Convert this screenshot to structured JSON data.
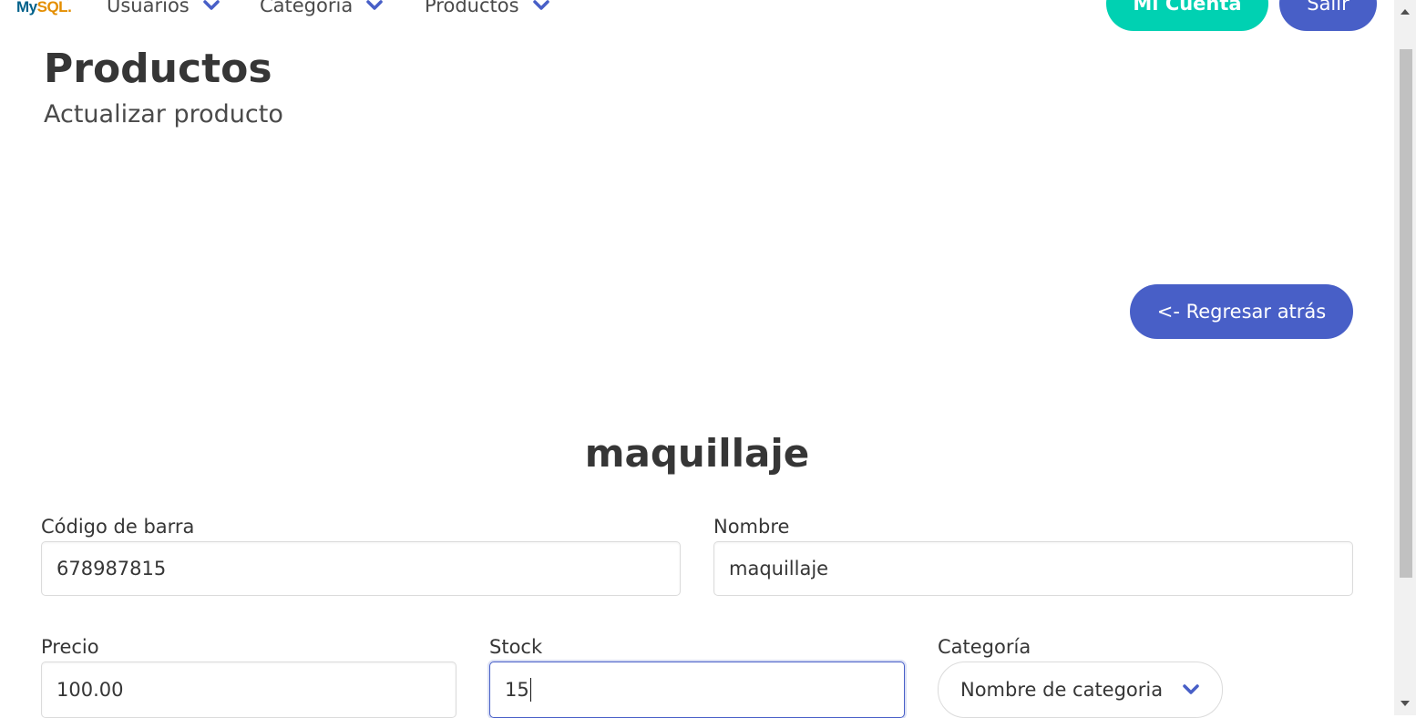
{
  "nav": {
    "logo": {
      "my": "My",
      "sql": "SQL",
      "suffix": "."
    },
    "items": [
      {
        "label": "Usuarios"
      },
      {
        "label": "Categoria"
      },
      {
        "label": "Productos"
      }
    ],
    "account_label": "Mi Cuenta",
    "logout_label": "Salir"
  },
  "header": {
    "title": "Productos",
    "subtitle": "Actualizar producto"
  },
  "back_button_label": "<- Regresar atrás",
  "product": {
    "name": "maquillaje"
  },
  "form": {
    "barcode": {
      "label": "Código de barra",
      "value": "678987815"
    },
    "name": {
      "label": "Nombre",
      "value": "maquillaje"
    },
    "price": {
      "label": "Precio",
      "value": "100.00"
    },
    "stock": {
      "label": "Stock",
      "value": "15"
    },
    "category": {
      "label": "Categoría",
      "selected": "Nombre de categoria"
    }
  },
  "colors": {
    "primary": "#485fc7",
    "success": "#00d1b2",
    "text": "#363636"
  }
}
